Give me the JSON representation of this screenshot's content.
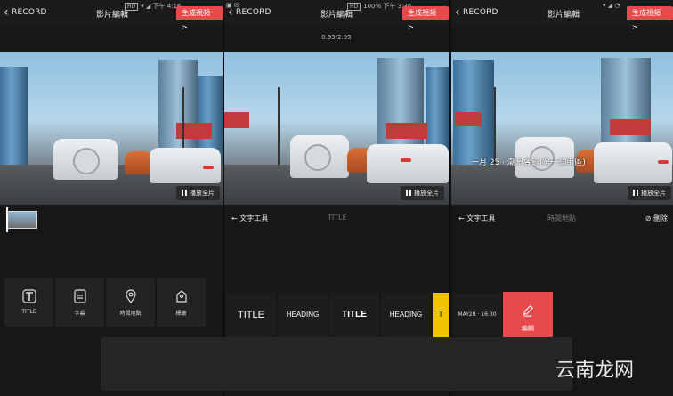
{
  "panel1": {
    "back_label": "RECORD",
    "title": "影片編輯",
    "status_time": "下午 4:16",
    "generate_label": "生成視頻 >",
    "play_label": "播放全片",
    "tools": [
      {
        "label": "TITLE",
        "icon": "text-t-icon"
      },
      {
        "label": "字幕",
        "icon": "subtitle-icon"
      },
      {
        "label": "時間地點",
        "icon": "location-pin-icon"
      },
      {
        "label": "標籤",
        "icon": "tag-icon"
      }
    ]
  },
  "panel2": {
    "back_label": "RECORD",
    "title": "影片編輯",
    "status_battery": "100%",
    "status_time": "下午 3:36",
    "generate_label": "生成視頻 >",
    "timecode": "0.95/2.55",
    "play_label": "播放全片",
    "tool_back": "文字工具",
    "tool_center": "TITLE",
    "styles": [
      "TITLE",
      "HEADING",
      "TITLE",
      "HEADING",
      "T"
    ]
  },
  "panel3": {
    "back_label": "RECORD",
    "title": "影片編輯",
    "generate_label": "生成視頻 >",
    "play_label": "播放全片",
    "overlay_text": "一月 25 · 潮州會館(第一個街區)",
    "tool_back": "文字工具",
    "tool_center": "時間地點",
    "delete_label": "刪除",
    "chip_label": "MAY28 · 16:30",
    "edit_label": "編輯"
  },
  "watermark": "云南龙网",
  "colors": {
    "accent": "#e74a4a",
    "background": "#171717"
  }
}
